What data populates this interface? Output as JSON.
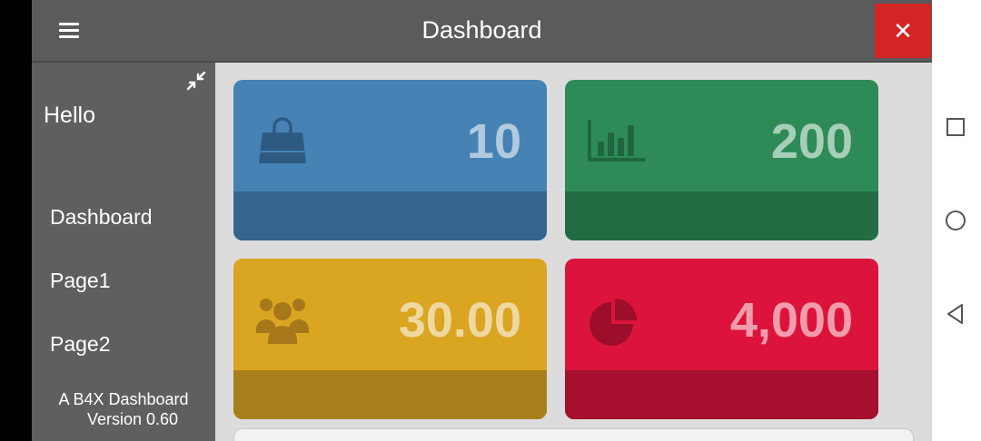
{
  "topbar": {
    "title": "Dashboard",
    "menu_icon": "hamburger-icon",
    "close_icon": "close-icon",
    "close_label": "✕",
    "close_color": "#d42424"
  },
  "sidebar": {
    "greeting": "Hello",
    "collapse_icon": "collapse-arrows-icon",
    "items": [
      {
        "label": "Dashboard"
      },
      {
        "label": "Page1"
      },
      {
        "label": "Page2"
      }
    ],
    "footer": {
      "line1": "A B4X Dashboard",
      "line2": "Version 0.60"
    }
  },
  "cards": [
    {
      "value": "10",
      "icon": "shopping-bag-icon",
      "color": "#4682b4",
      "band_color": "#35648f"
    },
    {
      "value": "200",
      "icon": "bar-chart-icon",
      "color": "#2e8b57",
      "band_color": "#236c43"
    },
    {
      "value": "30.00",
      "icon": "users-group-icon",
      "color": "#daa520",
      "band_color": "#a87f1b"
    },
    {
      "value": "4,000",
      "icon": "pie-chart-icon",
      "color": "#dc143c",
      "band_color": "#a60f2e"
    }
  ],
  "system_nav": {
    "recents_icon": "square-recents-icon",
    "home_icon": "circle-home-icon",
    "back_icon": "triangle-back-icon"
  }
}
